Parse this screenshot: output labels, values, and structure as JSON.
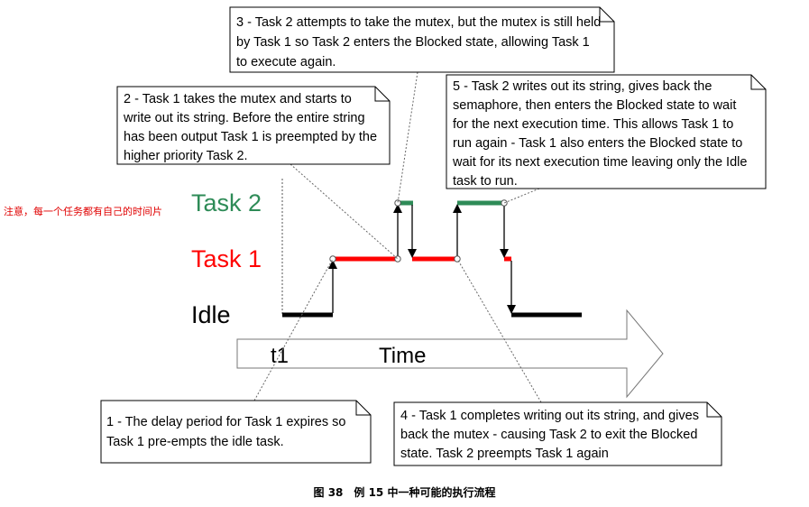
{
  "side_note": "注意，每一个任务都有自己的时间片",
  "caption": "图 38　例 15 中一种可能的执行流程",
  "labels": {
    "task2": "Task 2",
    "task1": "Task 1",
    "idle": "Idle",
    "t1": "t1",
    "time": "Time"
  },
  "colors": {
    "task2": "#2e8b57",
    "task1": "#ff0000",
    "idle": "#000000"
  },
  "notes": [
    {
      "id": "note-1",
      "lines": [
        "1 - The delay period for Task 1 expires so",
        "Task 1 pre-empts the idle task."
      ]
    },
    {
      "id": "note-2",
      "lines": [
        "2 - Task 1 takes the mutex and starts to",
        "write out its string. Before the entire string",
        "has been output Task 1 is preempted by the",
        "higher priority Task 2."
      ]
    },
    {
      "id": "note-3",
      "lines": [
        "3 - Task 2 attempts to take the mutex, but the mutex is still held",
        "by Task 1 so Task 2 enters the Blocked state, allowing Task 1",
        "to execute again."
      ]
    },
    {
      "id": "note-4",
      "lines": [
        "4 - Task 1 completes writing out its string, and gives",
        "back the mutex - causing Task 2 to exit the Blocked",
        "state.  Task 2 preempts Task 1 again"
      ]
    },
    {
      "id": "note-5",
      "lines": [
        "5 - Task 2 writes out its string, gives back the",
        "semaphore, then enters the Blocked state to wait",
        "for the next execution time.  This allows Task 1 to",
        "run again - Task 1 also enters the Blocked state to",
        "wait for its next execution time leaving only the Idle",
        "task to run."
      ]
    }
  ]
}
